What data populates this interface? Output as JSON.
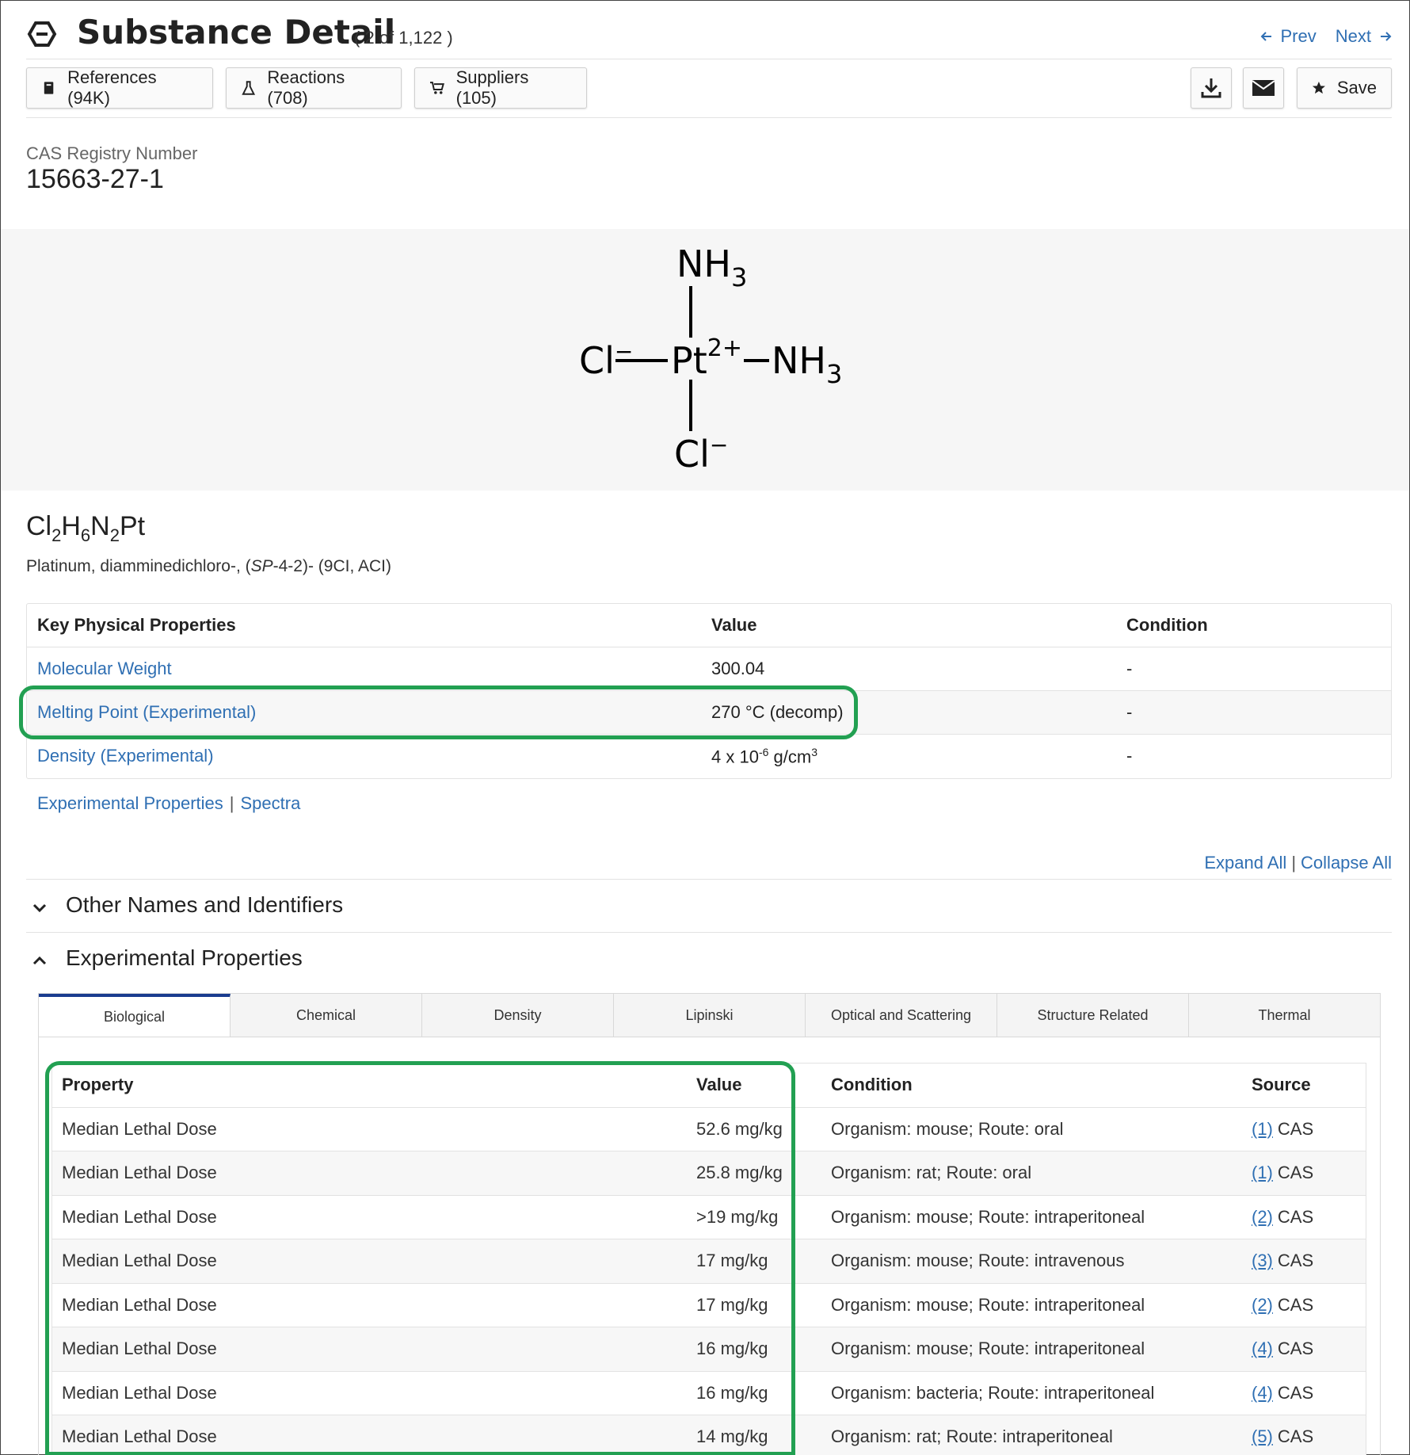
{
  "header": {
    "title": "Substance Detail",
    "count": "( 2 of 1,122 )",
    "prev_label": "Prev",
    "next_label": "Next"
  },
  "toolbar": {
    "references_label": "References (94K)",
    "reactions_label": "Reactions (708)",
    "suppliers_label": "Suppliers (105)",
    "save_label": "Save"
  },
  "substance": {
    "cas_label": "CAS Registry Number",
    "cas_number": "15663-27-1",
    "formula_parts": [
      "Cl",
      "2",
      "H",
      "6",
      "N",
      "2",
      "Pt"
    ],
    "name_prefix": "Platinum, diamminedichloro-, (",
    "name_italic": "SP",
    "name_suffix": "-4-2)- (9CI, ACI)"
  },
  "structure": {
    "top_group": "NH",
    "top_sub": "3",
    "left_atom": "Cl",
    "left_charge": "−",
    "center_atom": "Pt",
    "center_charge": "2+",
    "right_group": "NH",
    "right_sub": "3",
    "bottom_atom": "Cl",
    "bottom_charge": "−"
  },
  "key_properties": {
    "headers": [
      "Key Physical Properties",
      "Value",
      "Condition"
    ],
    "rows": [
      {
        "name": "Molecular Weight",
        "value": "300.04",
        "condition": "-"
      },
      {
        "name": "Melting Point (Experimental)",
        "value": "270 °C (decomp)",
        "condition": "-"
      },
      {
        "name": "Density (Experimental)",
        "value_base": "4 x 10",
        "value_exp": "-6",
        "value_unit": " g/cm",
        "value_unit_exp": "3",
        "condition": "-"
      }
    ]
  },
  "links": {
    "experimental": "Experimental Properties",
    "separator": "|",
    "spectra": "Spectra",
    "expand_all": "Expand All",
    "collapse_all": "Collapse All"
  },
  "sections": {
    "other_names": "Other Names and Identifiers",
    "experimental": "Experimental Properties"
  },
  "tabs": [
    "Biological",
    "Chemical",
    "Density",
    "Lipinski",
    "Optical and Scattering",
    "Structure Related",
    "Thermal"
  ],
  "bio_table": {
    "headers": [
      "Property",
      "Value",
      "Condition",
      "Source"
    ],
    "rows": [
      {
        "property": "Median Lethal Dose",
        "value": "52.6 mg/kg",
        "condition": "Organism: mouse; Route: oral",
        "ref": "(1)",
        "source": "CAS"
      },
      {
        "property": "Median Lethal Dose",
        "value": "25.8 mg/kg",
        "condition": "Organism: rat; Route: oral",
        "ref": "(1)",
        "source": "CAS"
      },
      {
        "property": "Median Lethal Dose",
        "value": ">19 mg/kg",
        "condition": "Organism: mouse; Route: intraperitoneal",
        "ref": "(2)",
        "source": "CAS"
      },
      {
        "property": "Median Lethal Dose",
        "value": "17 mg/kg",
        "condition": "Organism: mouse; Route: intravenous",
        "ref": "(3)",
        "source": "CAS"
      },
      {
        "property": "Median Lethal Dose",
        "value": "17 mg/kg",
        "condition": "Organism: mouse; Route: intraperitoneal",
        "ref": "(2)",
        "source": "CAS"
      },
      {
        "property": "Median Lethal Dose",
        "value": "16 mg/kg",
        "condition": "Organism: mouse; Route: intraperitoneal",
        "ref": "(4)",
        "source": "CAS"
      },
      {
        "property": "Median Lethal Dose",
        "value": "16 mg/kg",
        "condition": "Organism: bacteria; Route: intraperitoneal",
        "ref": "(4)",
        "source": "CAS"
      },
      {
        "property": "Median Lethal Dose",
        "value": "14 mg/kg",
        "condition": "Organism: rat; Route: intraperitoneal",
        "ref": "(5)",
        "source": "CAS"
      }
    ]
  },
  "colors": {
    "link": "#2f6fb3",
    "highlight": "#22a052",
    "active_tab": "#1a3c8f"
  },
  "icons": {
    "logo": "hexagon-icon",
    "prev": "arrow-left-icon",
    "next": "arrow-right-icon",
    "references": "book-icon",
    "reactions": "flask-icon",
    "suppliers": "cart-icon",
    "download": "download-icon",
    "email": "envelope-icon",
    "save": "star-icon",
    "collapsed": "chevron-down-icon",
    "expanded": "chevron-up-icon"
  }
}
